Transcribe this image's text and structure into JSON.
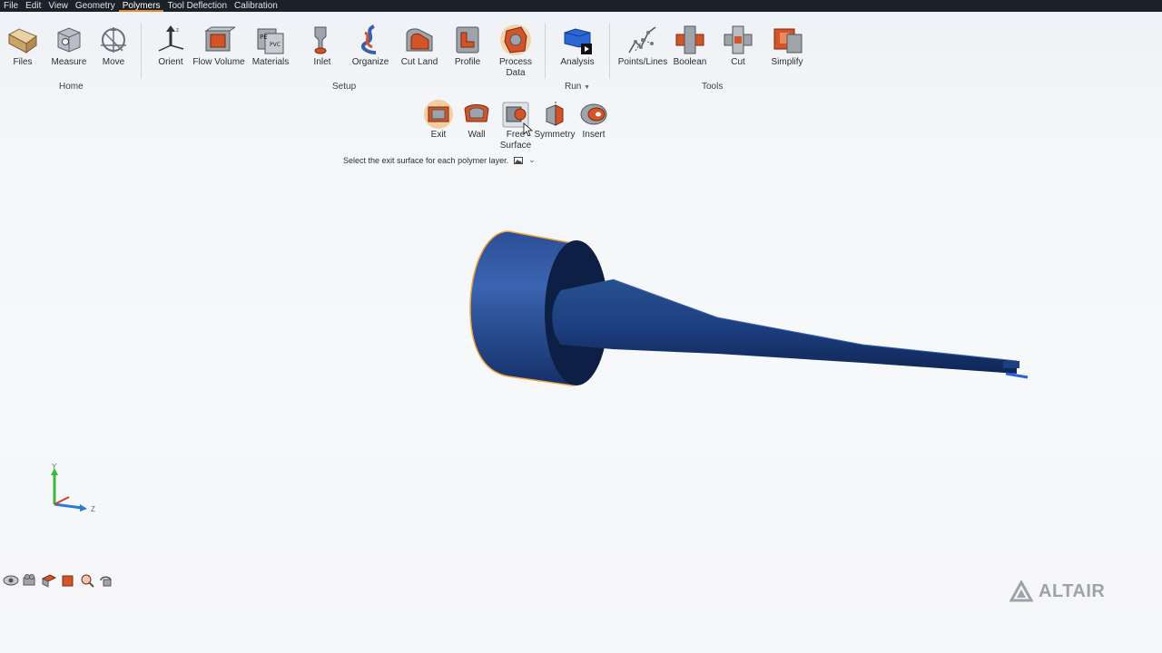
{
  "menu": {
    "items": [
      "File",
      "Edit",
      "View",
      "Geometry",
      "Polymers",
      "Tool Deflection",
      "Calibration"
    ],
    "active": "Polymers"
  },
  "ribbon": {
    "home": {
      "group_label": "Home",
      "tools": [
        "Files",
        "Measure",
        "Move"
      ]
    },
    "setup": {
      "group_label": "Setup",
      "tools": [
        "Orient",
        "Flow Volume",
        "Materials",
        "Inlet",
        "Organize",
        "Cut Land",
        "Profile"
      ],
      "process_data_line1": "Process",
      "process_data_line2": "Data"
    },
    "run": {
      "group_label": "Run",
      "tools": [
        "Analysis"
      ]
    },
    "tools": {
      "group_label": "Tools",
      "tools": [
        "Points/Lines",
        "Boolean",
        "Cut",
        "Simplify"
      ]
    }
  },
  "subribbon": {
    "exit": "Exit",
    "wall": "Wall",
    "free_surface_line1": "Free",
    "free_surface_line2": "Surface",
    "symmetry": "Symmetry",
    "insert": "Insert",
    "hint": "Select the exit surface for each polymer layer."
  },
  "triad": {
    "y": "Y",
    "z": "Z"
  },
  "brand": "ALTAIR",
  "colors": {
    "menubar": "#1c2129",
    "accent": "#e08a26",
    "model_blue": "#1e3f86",
    "model_edge": "#f0a23c"
  }
}
